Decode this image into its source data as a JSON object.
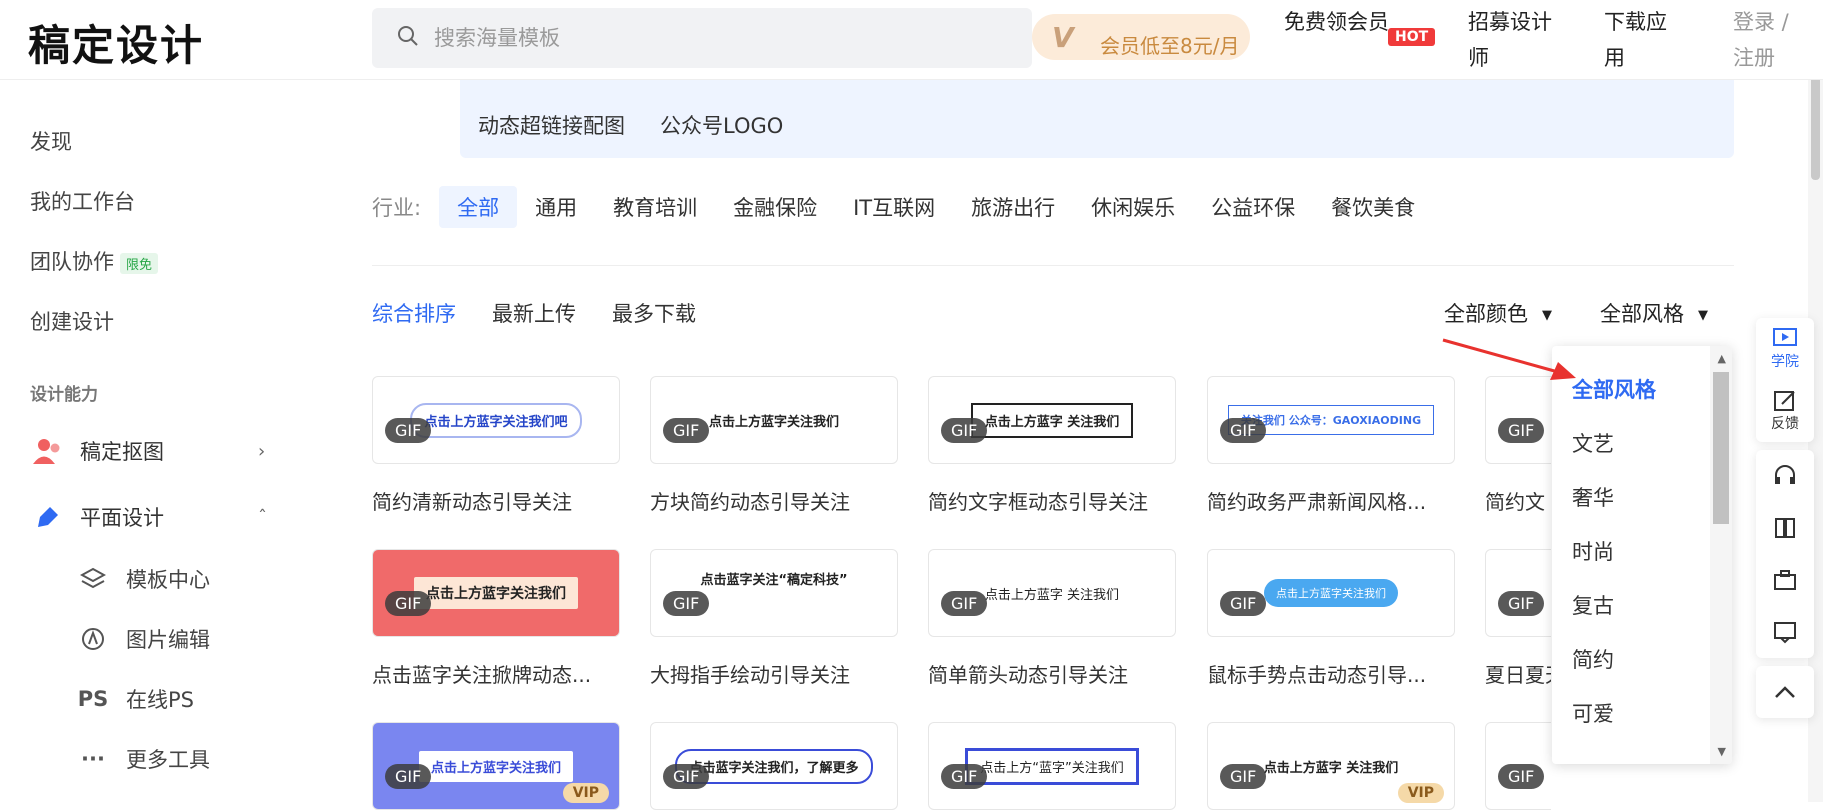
{
  "header": {
    "logo": "稿定设计",
    "search_placeholder": "搜索海量模板",
    "vip_promo": "会员低至8元/月",
    "vip_badge": "VIP",
    "nav": [
      "免费领会员",
      "招募设计师",
      "下载应用"
    ],
    "hot_badge": "HOT",
    "login": "登录 / 注册"
  },
  "sidebar": {
    "items": [
      "发现",
      "我的工作台",
      "团队协作",
      "创建设计"
    ],
    "free_tag": "限免",
    "section_title": "设计能力",
    "tools": [
      "稿定抠图",
      "平面设计"
    ],
    "subtools": [
      "模板中心",
      "图片编辑",
      "在线PS",
      "更多工具"
    ]
  },
  "tag_panel": {
    "tags": [
      "动态超链接配图",
      "公众号LOGO"
    ]
  },
  "industry": {
    "label": "行业:",
    "options": [
      "全部",
      "通用",
      "教育培训",
      "金融保险",
      "IT互联网",
      "旅游出行",
      "休闲娱乐",
      "公益环保",
      "餐饮美食"
    ]
  },
  "sort": {
    "options": [
      "综合排序",
      "最新上传",
      "最多下载"
    ],
    "color_filter": "全部颜色",
    "style_filter": "全部风格"
  },
  "style_dropdown": {
    "options": [
      "全部风格",
      "文艺",
      "奢华",
      "时尚",
      "复古",
      "简约",
      "可爱"
    ]
  },
  "cards": [
    {
      "title": "简约清新动态引导关注",
      "thumb": "点击上方蓝字关注我们吧",
      "badge": "GIF"
    },
    {
      "title": "方块简约动态引导关注",
      "thumb": "点击上方蓝字关注我们",
      "badge": "GIF"
    },
    {
      "title": "简约文字框动态引导关注",
      "thumb": "点击上方蓝字 关注我们",
      "badge": "GIF"
    },
    {
      "title": "简约政务严肃新闻风格...",
      "thumb": "关注我们 公众号：GAOXIAODING",
      "badge": "GIF"
    },
    {
      "title": "简约文",
      "thumb": "",
      "badge": "GIF"
    },
    {
      "title": "点击蓝字关注掀牌动态...",
      "thumb": "点击上方蓝字关注我们",
      "badge": "GIF"
    },
    {
      "title": "大拇指手绘动引导关注",
      "thumb": "点击蓝字关注“稿定科技”",
      "badge": "GIF"
    },
    {
      "title": "简单箭头动态引导关注",
      "thumb": "点击上方蓝字 关注我们",
      "badge": "GIF"
    },
    {
      "title": "鼠标手势点击动态引导...",
      "thumb": "点击上方蓝字关注我们",
      "badge": "GIF"
    },
    {
      "title": "夏日夏天",
      "thumb": "",
      "badge": "GIF"
    },
    {
      "title": "",
      "thumb": "点击上方蓝字关注我们",
      "badge": "GIF",
      "vip": "VIP"
    },
    {
      "title": "",
      "thumb": "点击蓝字关注我们，了解更多",
      "badge": "GIF"
    },
    {
      "title": "",
      "thumb": "点击上方“蓝字”关注我们",
      "badge": "GIF"
    },
    {
      "title": "",
      "thumb": "点击上方蓝字 关注我们",
      "badge": "GIF",
      "vip": "VIP"
    },
    {
      "title": "",
      "thumb": "",
      "badge": "GIF"
    }
  ],
  "floatbar": {
    "academy": "学院",
    "feedback": "反馈"
  },
  "colors": {
    "accent": "#2f6af2",
    "hot": "#f03a3a",
    "annotation": "#e8322e"
  }
}
